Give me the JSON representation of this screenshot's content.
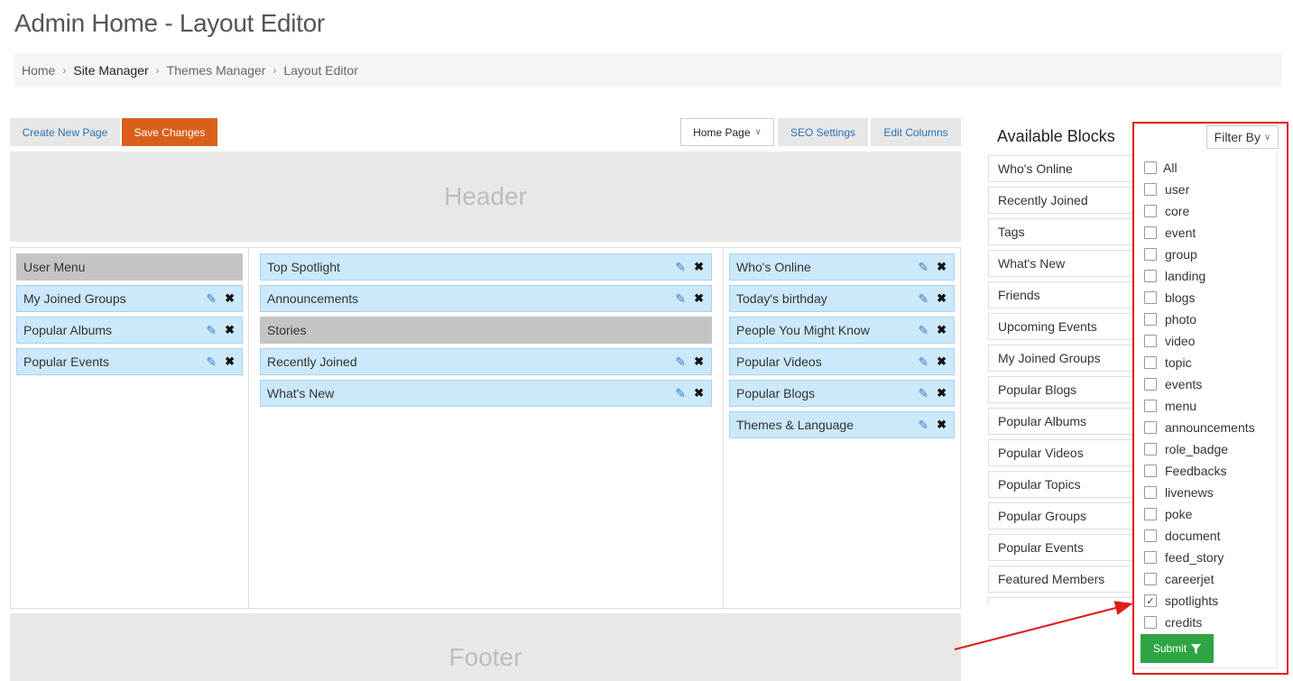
{
  "page": {
    "title": "Admin Home - Layout Editor"
  },
  "breadcrumb": [
    "Home",
    "Site Manager",
    "Themes Manager",
    "Layout Editor"
  ],
  "toolbar": {
    "create_label": "Create New Page",
    "save_label": "Save Changes",
    "page_select": "Home Page",
    "seo_label": "SEO Settings",
    "columns_label": "Edit Columns"
  },
  "regions": {
    "header": "Header",
    "footer": "Footer"
  },
  "columns": {
    "left": [
      {
        "label": "User Menu",
        "group": true
      },
      {
        "label": "My Joined Groups",
        "group": false
      },
      {
        "label": "Popular Albums",
        "group": false
      },
      {
        "label": "Popular Events",
        "group": false
      }
    ],
    "center": [
      {
        "label": "Top Spotlight",
        "group": false
      },
      {
        "label": "Announcements",
        "group": false
      },
      {
        "label": "Stories",
        "group": true
      },
      {
        "label": "Recently Joined",
        "group": false
      },
      {
        "label": "What's New",
        "group": false
      }
    ],
    "right": [
      {
        "label": "Who's Online",
        "group": false
      },
      {
        "label": "Today's birthday",
        "group": false
      },
      {
        "label": "People You Might Know",
        "group": false
      },
      {
        "label": "Popular Videos",
        "group": false
      },
      {
        "label": "Popular Blogs",
        "group": false
      },
      {
        "label": "Themes & Language",
        "group": false
      }
    ]
  },
  "available": {
    "title": "Available Blocks",
    "items": [
      "Who's Online",
      "Recently Joined",
      "Tags",
      "What's New",
      "Friends",
      "Upcoming Events",
      "My Joined Groups",
      "Popular Blogs",
      "Popular Albums",
      "Popular Videos",
      "Popular Topics",
      "Popular Groups",
      "Popular Events",
      "Featured Members",
      ""
    ]
  },
  "filter": {
    "label": "Filter By",
    "options": [
      {
        "label": "All",
        "checked": false
      },
      {
        "label": "user",
        "checked": false
      },
      {
        "label": "core",
        "checked": false
      },
      {
        "label": "event",
        "checked": false
      },
      {
        "label": "group",
        "checked": false
      },
      {
        "label": "landing",
        "checked": false
      },
      {
        "label": "blogs",
        "checked": false
      },
      {
        "label": "photo",
        "checked": false
      },
      {
        "label": "video",
        "checked": false
      },
      {
        "label": "topic",
        "checked": false
      },
      {
        "label": "events",
        "checked": false
      },
      {
        "label": "menu",
        "checked": false
      },
      {
        "label": "announcements",
        "checked": false
      },
      {
        "label": "role_badge",
        "checked": false
      },
      {
        "label": "Feedbacks",
        "checked": false
      },
      {
        "label": "livenews",
        "checked": false
      },
      {
        "label": "poke",
        "checked": false
      },
      {
        "label": "document",
        "checked": false
      },
      {
        "label": "feed_story",
        "checked": false
      },
      {
        "label": "careerjet",
        "checked": false
      },
      {
        "label": "spotlights",
        "checked": true
      },
      {
        "label": "credits",
        "checked": false
      }
    ],
    "submit_label": "Submit"
  },
  "colors": {
    "accent_blue": "#2c72b5",
    "save_orange": "#d9601a",
    "block_blue": "#cce9fb",
    "submit_green": "#2ea543",
    "annotation_red": "#e01b1b"
  },
  "icons": {
    "edit": "pencil-icon",
    "remove": "close-icon",
    "filter": "funnel-icon",
    "dropdown": "chevron-down-icon"
  }
}
